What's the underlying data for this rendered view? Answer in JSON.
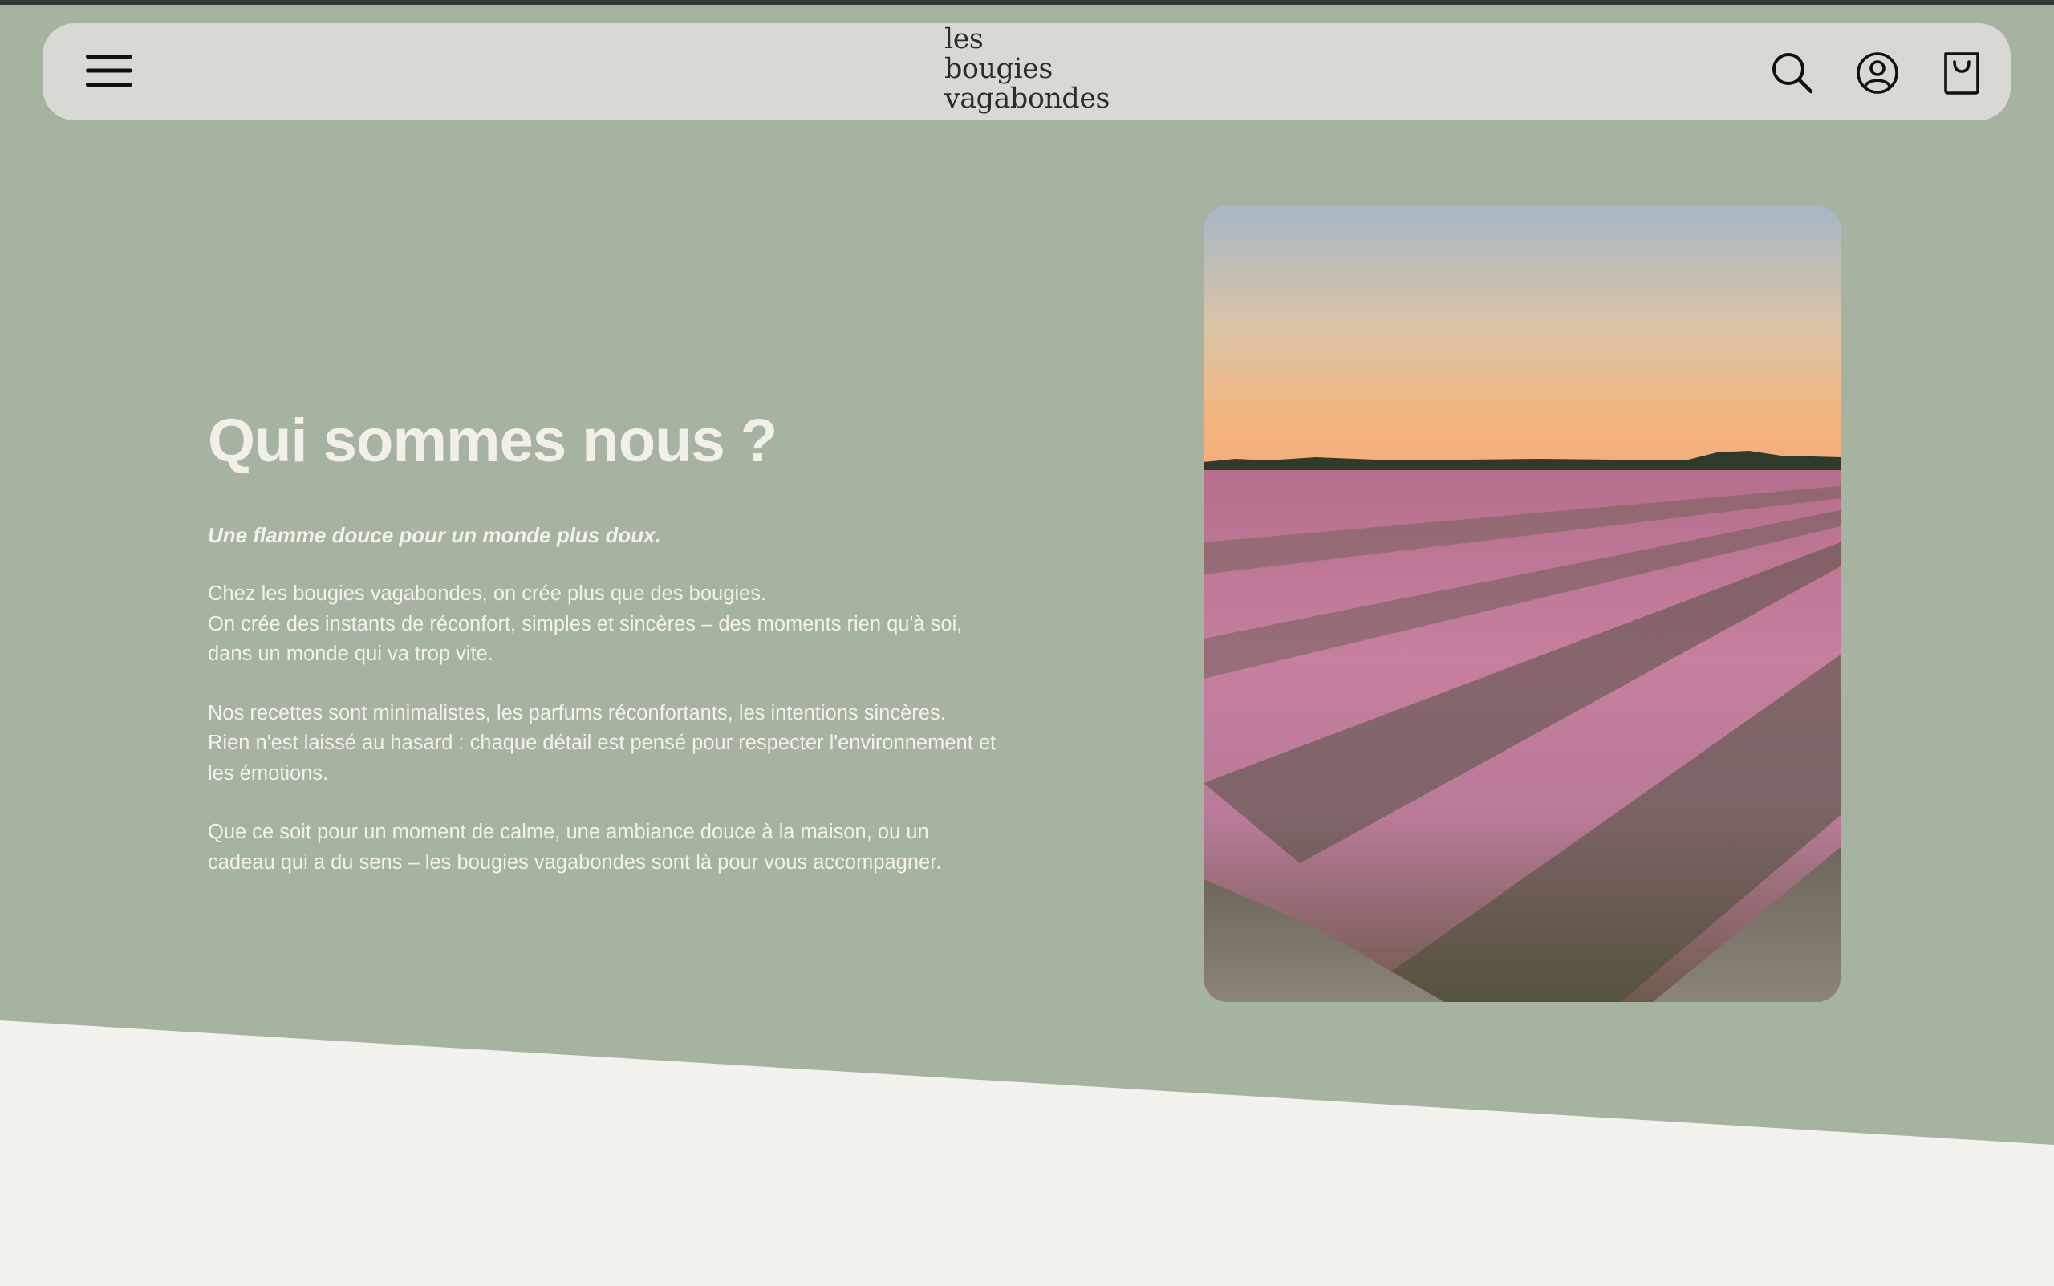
{
  "header": {
    "logo_lines": [
      "les",
      "bougies",
      "vagabondes"
    ],
    "icons": {
      "menu": "hamburger-menu-icon",
      "search": "search-icon",
      "account": "account-icon",
      "cart": "shopping-bag-icon"
    }
  },
  "about": {
    "title": "Qui sommes nous ?",
    "tagline": "Une flamme douce pour un monde plus doux.",
    "paragraphs": [
      {
        "lines": [
          "Chez les bougies vagabondes, on crée plus que des bougies.",
          "On crée des instants de réconfort, simples et sincères – des moments rien qu'à soi,",
          "dans un monde qui va trop vite."
        ]
      },
      {
        "lines": [
          "Nos recettes sont minimalistes, les parfums réconfortants, les intentions sincères.",
          "Rien n'est laissé au hasard : chaque détail est pensé pour respecter l'environnement et",
          "les émotions."
        ]
      },
      {
        "lines": [
          "Que ce soit pour un moment de calme, une ambiance douce à la maison, ou un",
          "cadeau qui a du sens – les bougies vagabondes sont là pour vous accompagner."
        ]
      }
    ]
  },
  "colors": {
    "background": "#a6b3a1",
    "header_bg": "#d8d9d3",
    "text_light": "#f3f1eb",
    "cream_band": "#f3f1eb"
  }
}
